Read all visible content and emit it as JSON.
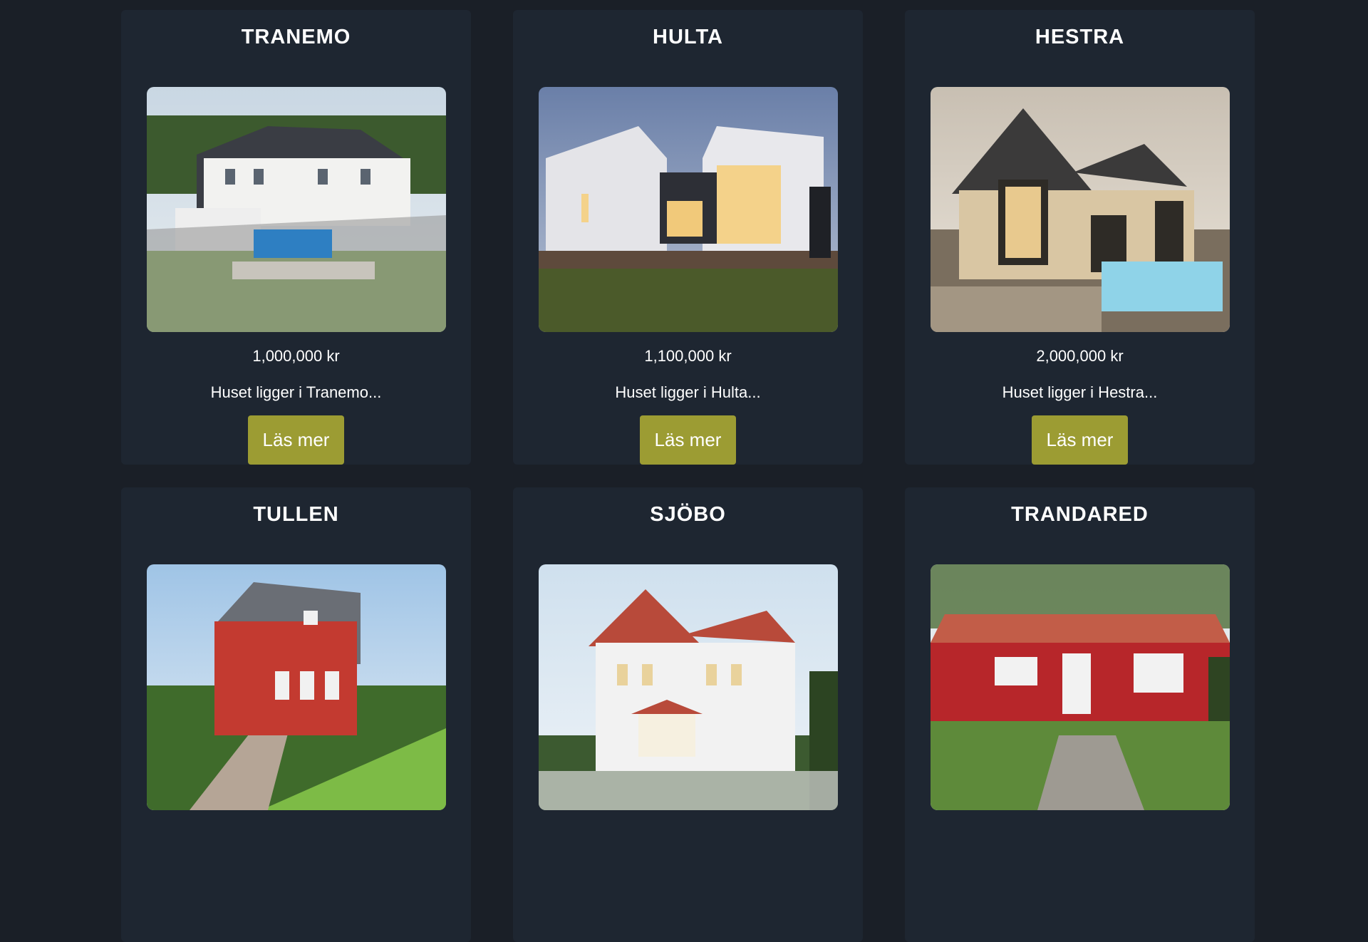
{
  "colors": {
    "background": "#1a1f27",
    "card": "#1e2631",
    "button": "#9c9c33"
  },
  "cards": [
    {
      "title": "TRANEMO",
      "price": "1,000,000 kr",
      "description": "Huset ligger i Tranemo...",
      "button_label": "Läs mer",
      "image_alt": "white house with pool",
      "image_name": "tranemo-house-image"
    },
    {
      "title": "HULTA",
      "price": "1,100,000 kr",
      "description": "Huset ligger i Hulta...",
      "button_label": "Läs mer",
      "image_alt": "modern white house at dusk",
      "image_name": "hulta-house-image"
    },
    {
      "title": "HESTRA",
      "price": "2,000,000 kr",
      "description": "Huset ligger i Hestra...",
      "button_label": "Läs mer",
      "image_alt": "beige house with pool",
      "image_name": "hestra-house-image"
    },
    {
      "title": "TULLEN",
      "price": "",
      "description": "",
      "button_label": "",
      "image_alt": "red wooden house",
      "image_name": "tullen-house-image"
    },
    {
      "title": "SJÖBO",
      "price": "",
      "description": "",
      "button_label": "",
      "image_alt": "white two-storey house",
      "image_name": "sjobo-house-image"
    },
    {
      "title": "TRANDARED",
      "price": "",
      "description": "",
      "button_label": "",
      "image_alt": "red cottage",
      "image_name": "trandared-house-image"
    }
  ]
}
